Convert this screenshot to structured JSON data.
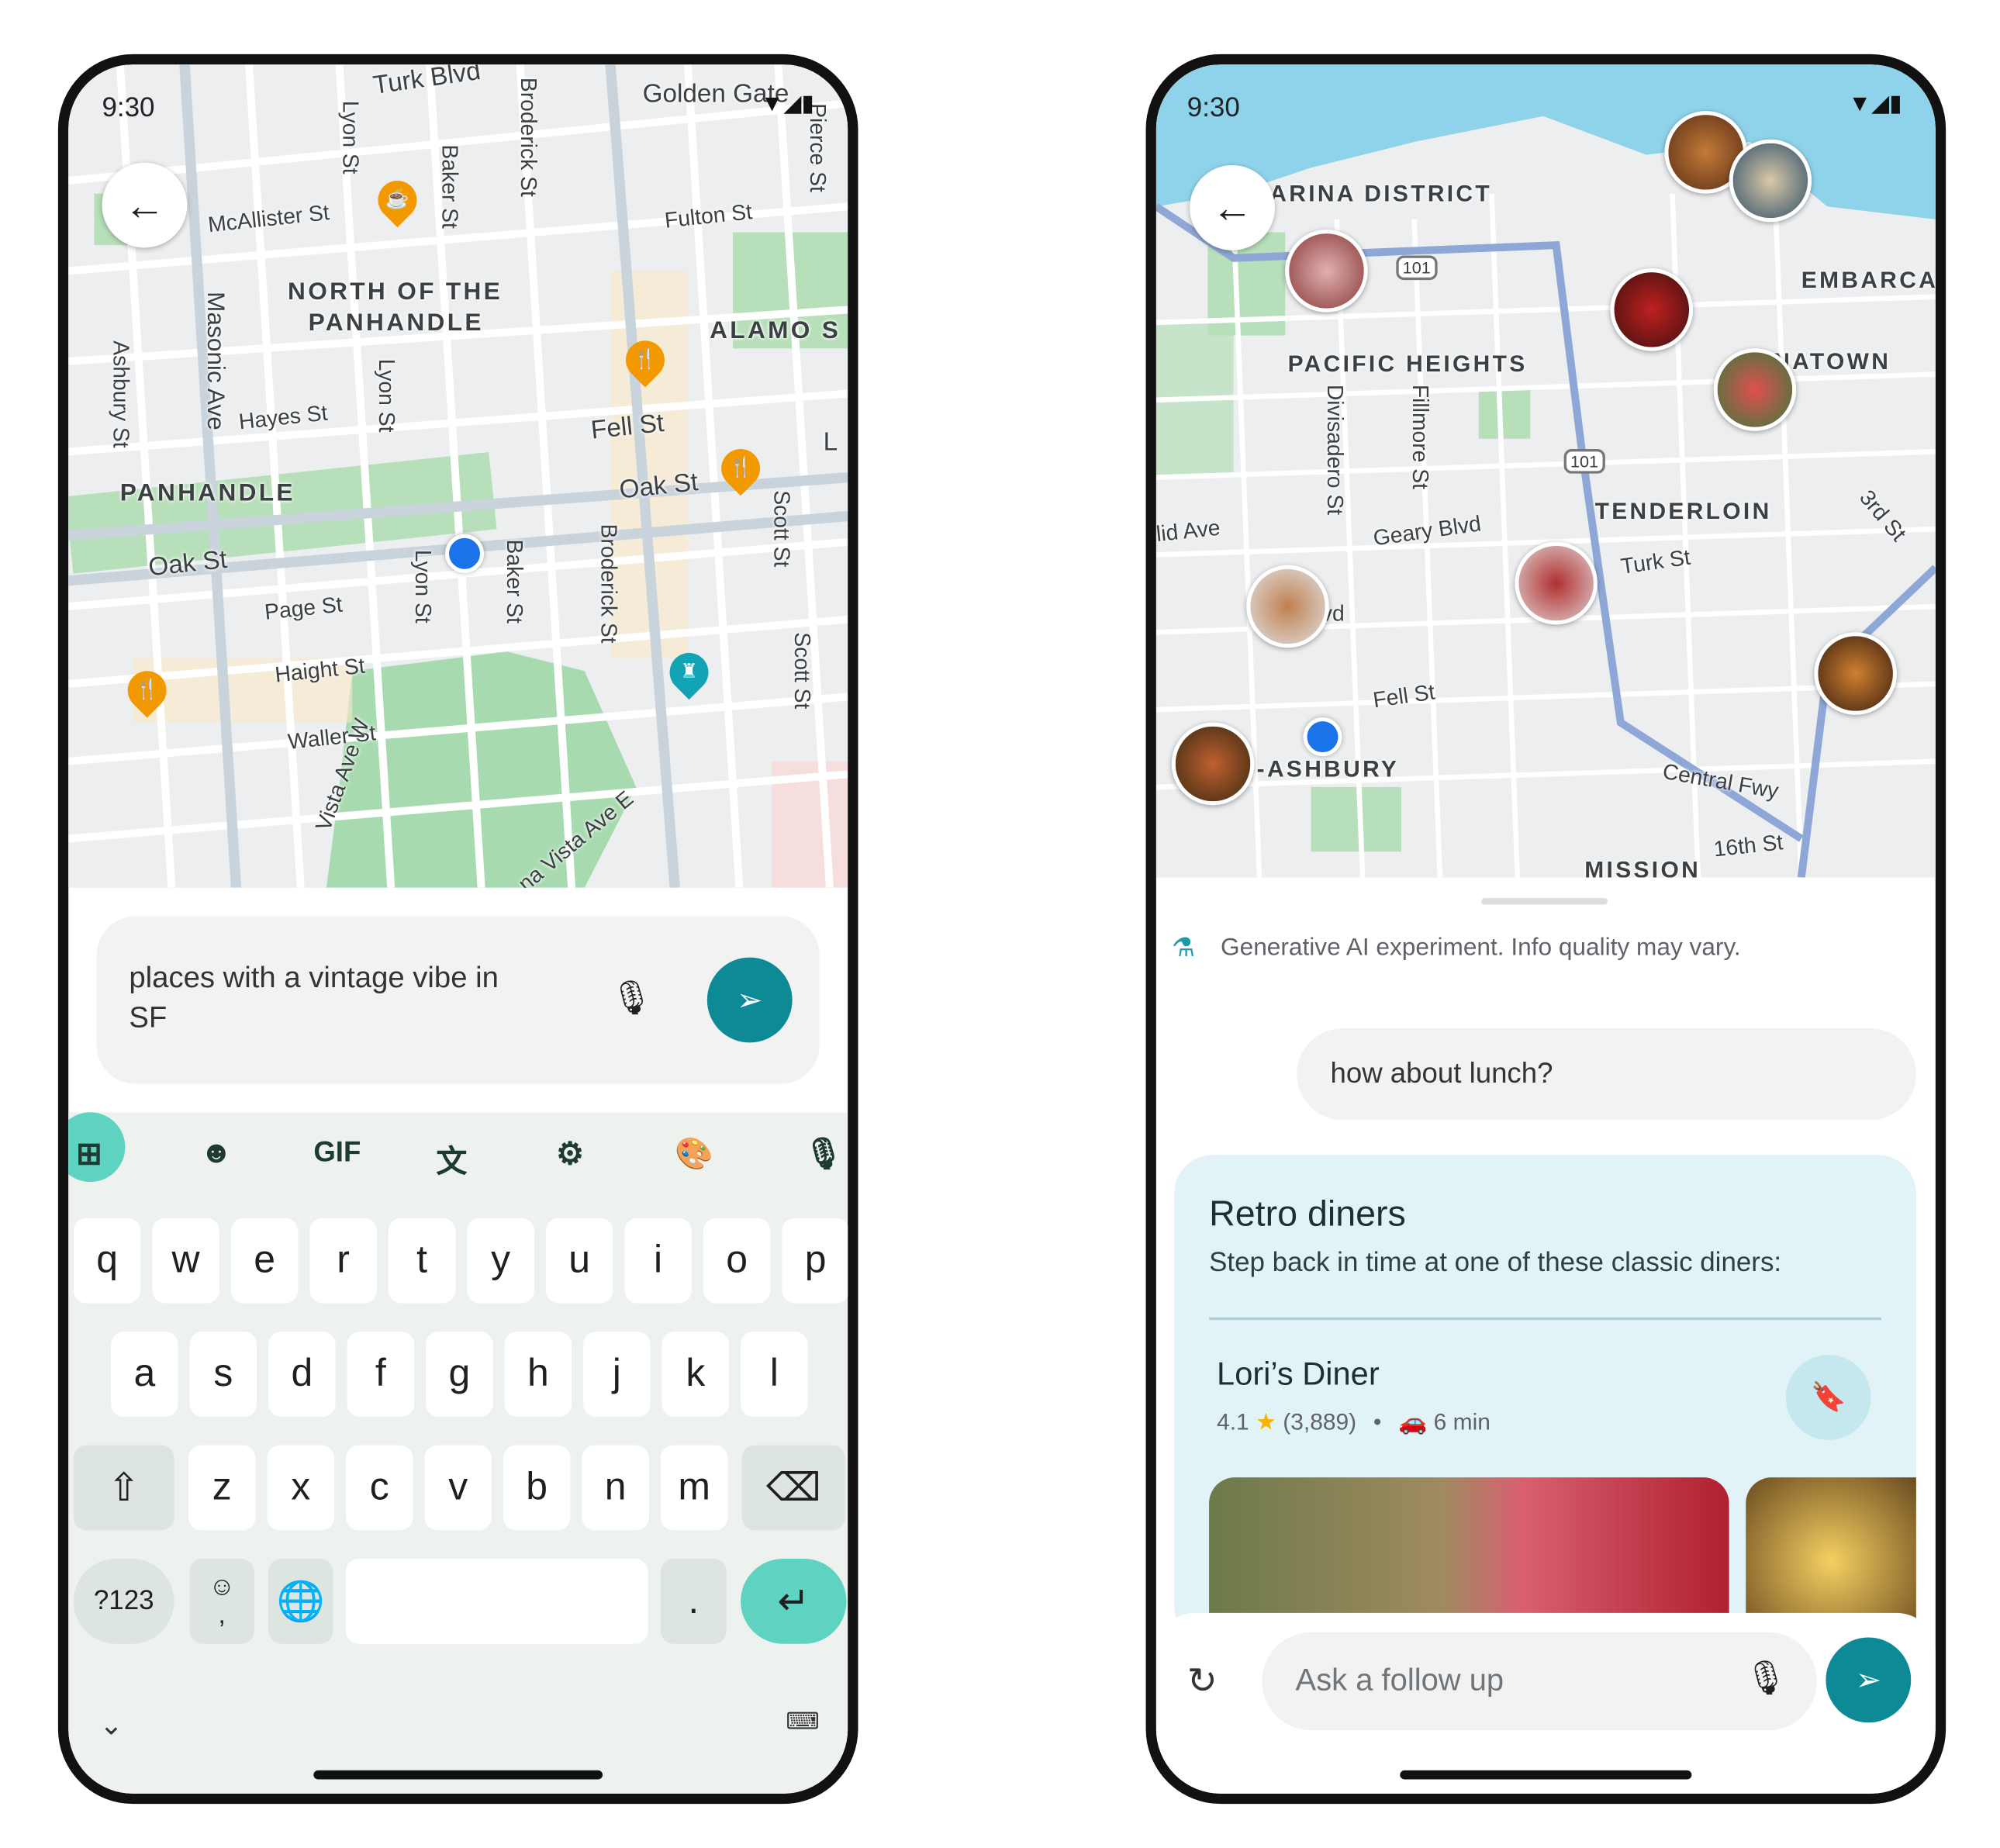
{
  "left_phone": {
    "status_time": "9:30",
    "map_labels": [
      "Turk Blvd",
      "Golden Gate",
      "Lyon St",
      "Baker St",
      "Broderick St",
      "Pierce St",
      "McAllister St",
      "Fulton St",
      "NORTH OF THE",
      "PANHANDLE",
      "ALAMO S",
      "Masonic Ave",
      "Ashbury St",
      "Hayes St",
      "Lyon St",
      "Fell St",
      "L",
      "PANHANDLE",
      "Oak St",
      "Oak St",
      "Scott St",
      "Lyon St",
      "Baker St",
      "Broderick St",
      "Page St",
      "Haight St",
      "Waller St",
      "Scott St",
      "Vista Ave W",
      "na Vista Ave E"
    ],
    "search_query": "places with a vintage vibe in SF",
    "keyboard": {
      "toolbar": [
        "apps-icon",
        "sticker-icon",
        "GIF",
        "translate-icon",
        "gear-icon",
        "palette-icon",
        "mic-icon"
      ],
      "row1": [
        "q",
        "w",
        "e",
        "r",
        "t",
        "y",
        "u",
        "i",
        "o",
        "p"
      ],
      "row2": [
        "a",
        "s",
        "d",
        "f",
        "g",
        "h",
        "j",
        "k",
        "l"
      ],
      "row3": [
        "z",
        "x",
        "c",
        "v",
        "b",
        "n",
        "m"
      ],
      "symbols_label": "?123",
      "emoji_comma": "☺\n,",
      "period": "."
    },
    "colors": {
      "send": "#0e8a96",
      "enter": "#5fd3c2",
      "pin": "#f29900"
    }
  },
  "right_phone": {
    "status_time": "9:30",
    "map_labels": [
      "ARINA DISTRICT",
      "EMBARCA",
      "PACIFIC HEIGHTS",
      "NATOWN",
      "Divisadero St",
      "Fillmore St",
      "TENDERLOIN",
      "lid Ave",
      "Geary Blvd",
      "Turk St",
      "3rd St",
      "vd",
      "Fell St",
      "-ASHBURY",
      "Central Fwy",
      "16th St",
      "MISSION",
      "101",
      "101"
    ],
    "ai_notice": "Generative AI experiment. Info quality may vary.",
    "user_message": "how about lunch?",
    "card": {
      "title": "Retro diners",
      "subtitle": "Step back in time at one of these classic diners:",
      "place": {
        "name": "Lori’s Diner",
        "rating": "4.1",
        "reviews": "(3,889)",
        "separator": "•",
        "drive_time": "6 min"
      }
    },
    "followup_placeholder": "Ask a follow up"
  }
}
